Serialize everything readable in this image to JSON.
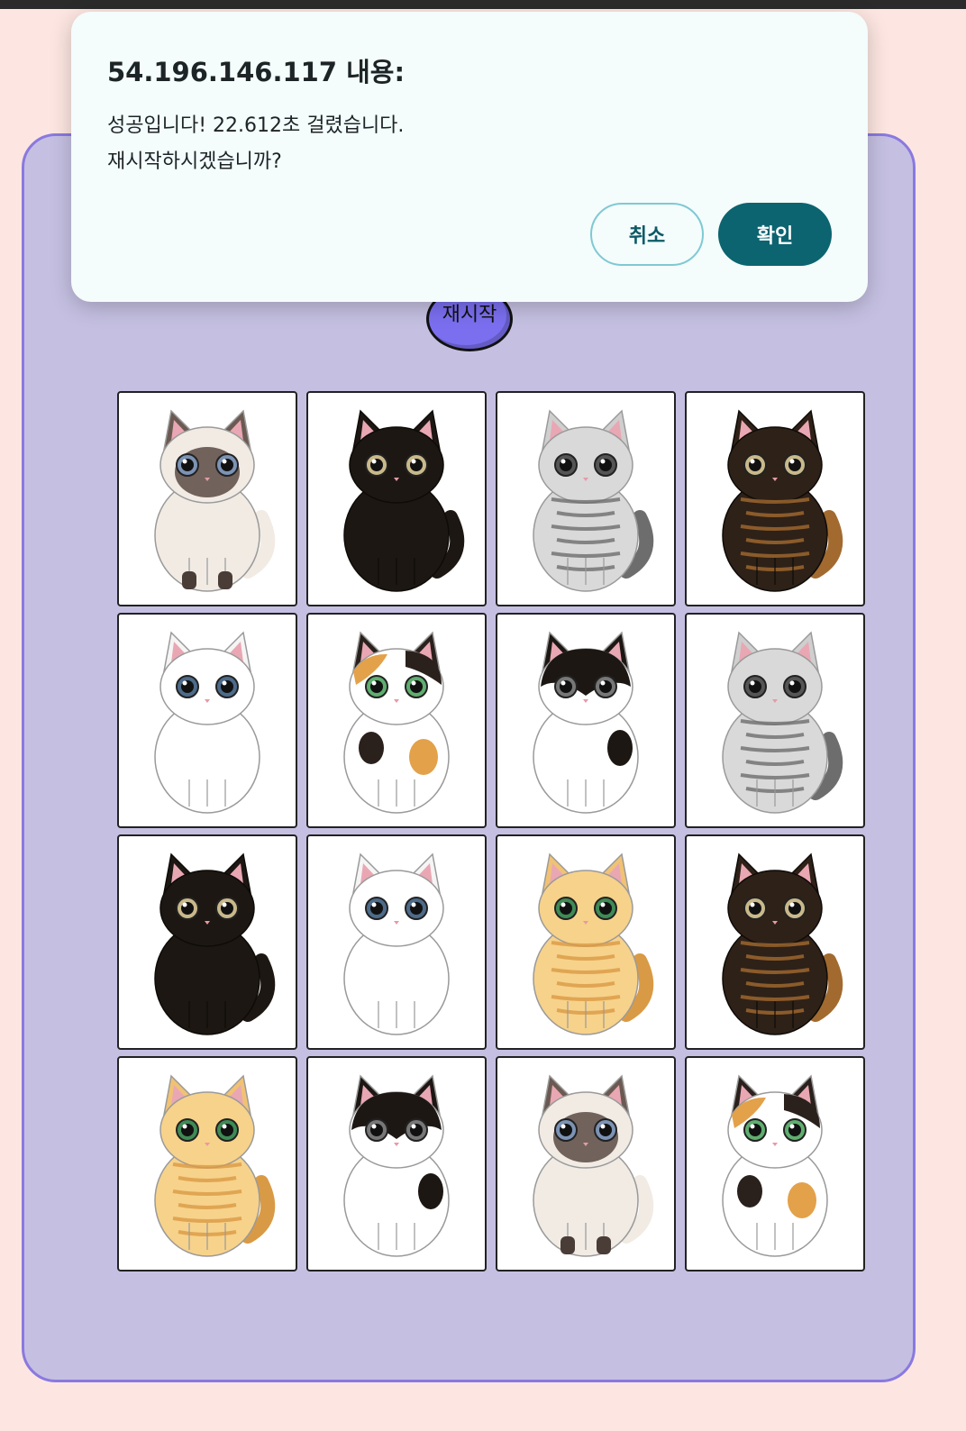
{
  "dialog": {
    "title": "54.196.146.117 내용:",
    "message_line1": "성공입니다! 22.612초 걸렸습니다.",
    "message_line2": "재시작하시겠습니까?",
    "cancel_label": "취소",
    "ok_label": "확인",
    "accent_color": "#0b6470"
  },
  "game": {
    "restart_label": "재시작",
    "panel_color": "#c5c0e2",
    "cards": [
      {
        "cat": "siamese"
      },
      {
        "cat": "black"
      },
      {
        "cat": "silver-tabby"
      },
      {
        "cat": "tortoiseshell"
      },
      {
        "cat": "white"
      },
      {
        "cat": "calico"
      },
      {
        "cat": "tuxedo"
      },
      {
        "cat": "silver-tabby"
      },
      {
        "cat": "black"
      },
      {
        "cat": "white"
      },
      {
        "cat": "orange-tabby"
      },
      {
        "cat": "tortoiseshell"
      },
      {
        "cat": "orange-tabby"
      },
      {
        "cat": "tuxedo"
      },
      {
        "cat": "siamese"
      },
      {
        "cat": "calico"
      }
    ]
  }
}
